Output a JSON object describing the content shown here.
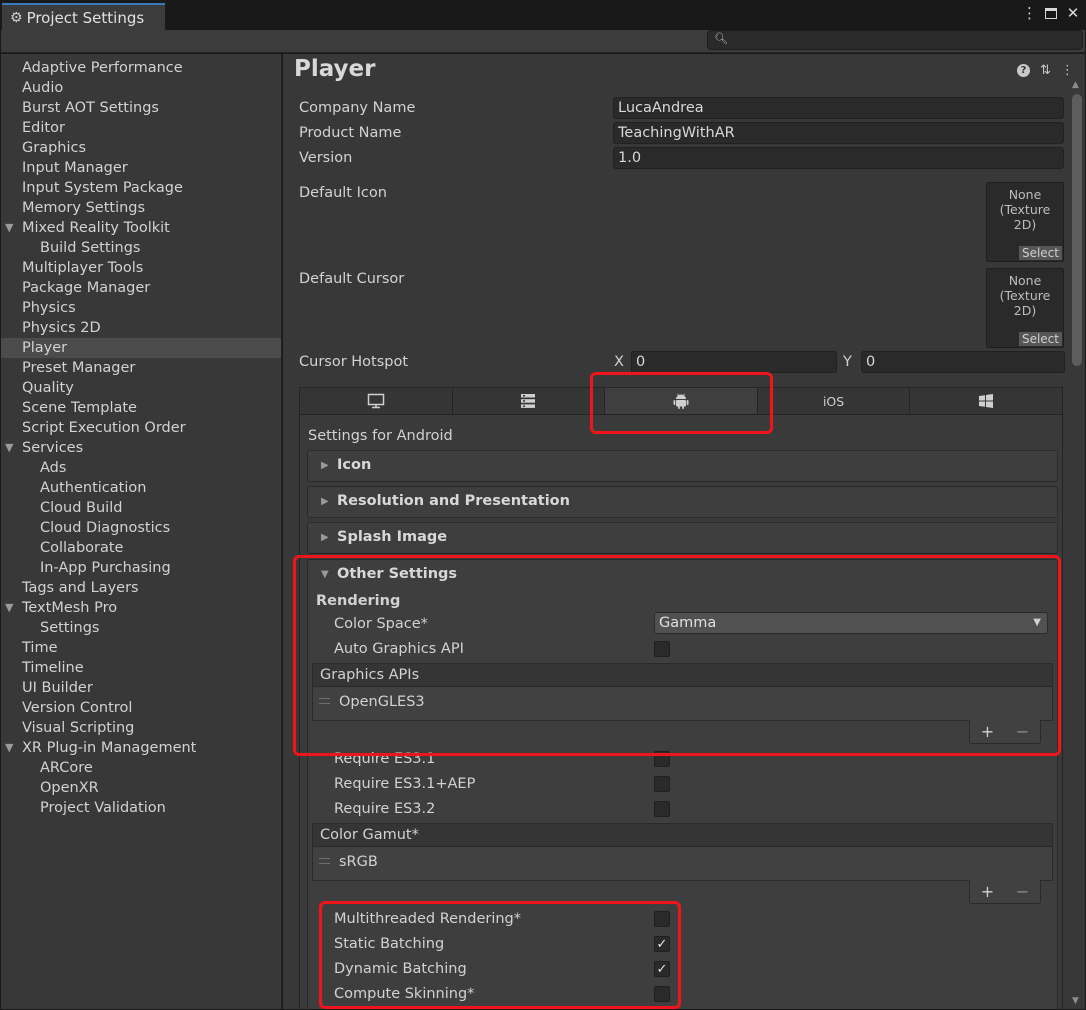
{
  "window": {
    "tab_title": "Project Settings"
  },
  "search": {
    "placeholder": ""
  },
  "sidebar": {
    "items": [
      {
        "label": "Adaptive Performance"
      },
      {
        "label": "Audio"
      },
      {
        "label": "Burst AOT Settings"
      },
      {
        "label": "Editor"
      },
      {
        "label": "Graphics"
      },
      {
        "label": "Input Manager"
      },
      {
        "label": "Input System Package"
      },
      {
        "label": "Memory Settings"
      },
      {
        "label": "Mixed Reality Toolkit"
      },
      {
        "label": "Build Settings"
      },
      {
        "label": "Multiplayer Tools"
      },
      {
        "label": "Package Manager"
      },
      {
        "label": "Physics"
      },
      {
        "label": "Physics 2D"
      },
      {
        "label": "Player"
      },
      {
        "label": "Preset Manager"
      },
      {
        "label": "Quality"
      },
      {
        "label": "Scene Template"
      },
      {
        "label": "Script Execution Order"
      },
      {
        "label": "Services"
      },
      {
        "label": "Ads"
      },
      {
        "label": "Authentication"
      },
      {
        "label": "Cloud Build"
      },
      {
        "label": "Cloud Diagnostics"
      },
      {
        "label": "Collaborate"
      },
      {
        "label": "In-App Purchasing"
      },
      {
        "label": "Tags and Layers"
      },
      {
        "label": "TextMesh Pro"
      },
      {
        "label": "Settings"
      },
      {
        "label": "Time"
      },
      {
        "label": "Timeline"
      },
      {
        "label": "UI Builder"
      },
      {
        "label": "Version Control"
      },
      {
        "label": "Visual Scripting"
      },
      {
        "label": "XR Plug-in Management"
      },
      {
        "label": "ARCore"
      },
      {
        "label": "OpenXR"
      },
      {
        "label": "Project Validation"
      }
    ]
  },
  "player": {
    "title": "Player",
    "company_name_label": "Company Name",
    "company_name": "LucaAndrea",
    "product_name_label": "Product Name",
    "product_name": "TeachingWithAR",
    "version_label": "Version",
    "version": "1.0",
    "default_icon_label": "Default Icon",
    "default_cursor_label": "Default Cursor",
    "slot_none": "None",
    "slot_type": "(Texture 2D)",
    "slot_select": "Select",
    "cursor_hotspot_label": "Cursor Hotspot",
    "hotspot_x_label": "X",
    "hotspot_x": "0",
    "hotspot_y_label": "Y",
    "hotspot_y": "0"
  },
  "platform_tabs": {
    "ios_label": "iOS"
  },
  "android": {
    "settings_for": "Settings for Android",
    "sections": {
      "icon": "Icon",
      "resolution": "Resolution and Presentation",
      "splash": "Splash Image",
      "other": "Other Settings"
    },
    "rendering_label": "Rendering",
    "color_space_label": "Color Space*",
    "color_space_value": "Gamma",
    "auto_graphics_api_label": "Auto Graphics API",
    "graphics_apis_header": "Graphics APIs",
    "graphics_api_entry": "OpenGLES3",
    "require_es31": "Require ES3.1",
    "require_es31_aep": "Require ES3.1+AEP",
    "require_es32": "Require ES3.2",
    "color_gamut_header": "Color Gamut*",
    "color_gamut_entry": "sRGB",
    "multithreaded_label": "Multithreaded Rendering*",
    "static_batching_label": "Static Batching",
    "dynamic_batching_label": "Dynamic Batching",
    "compute_skinning_label": "Compute Skinning*",
    "checks": {
      "auto_graphics_api": false,
      "require_es31": false,
      "require_es31_aep": false,
      "require_es32": false,
      "multithreaded": false,
      "static_batching": true,
      "dynamic_batching": true,
      "compute_skinning": false
    }
  },
  "colors": {
    "highlight": "#f0141b",
    "accent": "#3a79bb"
  }
}
